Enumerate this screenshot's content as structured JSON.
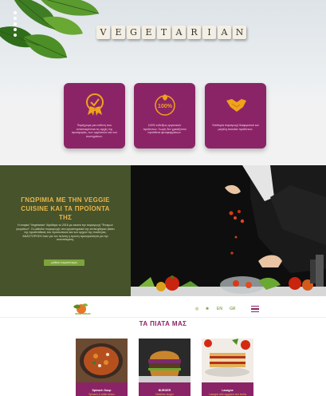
{
  "hero": {
    "tiles": [
      "V",
      "E",
      "G",
      "E",
      "T",
      "A",
      "R",
      "I",
      "A",
      "N"
    ]
  },
  "features": [
    {
      "icon": "award-badge-icon",
      "text": "Παρέχουμε μια ευθύνη που ανταποκρίνεται τις αρχές της προσφοράς, των οργανικών και των συστημάτων."
    },
    {
      "icon": "natural-100-icon",
      "text": "100% ενδείξεις οργανικών προϊόντων. Χωρίς δεν χρειάζονται πρόσθετα φυτοφαρμάκων."
    },
    {
      "icon": "handshake-icon",
      "text": "Επιθυμία παραγωγή διαφορετικό και μεγάλη ποικιλία προϊόντων."
    }
  ],
  "know": {
    "title": "ΓΝΩΡΙΜΙΑ ΜΕ ΤΗΝ VEGGIE CUISINE ΚΑΙ ΤΑ ΠΡΟΪΟΝΤΑ ΤΗΣ",
    "text": "Η εταιρία \"Vegetarian\" ιδρύθηκε το 2016 με σκοπό την παραγωγή \"Έτοιμων γευμάτων\". Οι μέθοδοι παραγωγής στα εργαστηριακά της επιτεύχθηκαν βάσει της προσπάθειας του προσωπικού και των αρχών της ποιότητας. ΑΝΑΣΤΟΡΗΣΗ όταν για τον πελάτη η πρώτη προτεραιότητά για την ανταπόκριση.",
    "button": "μάθετε περισσότερα"
  },
  "nav": {
    "logo_text": "VEGETARIAN",
    "lang_en": "EN",
    "lang_gr": "GR"
  },
  "dishes": {
    "title": "ΤΑ ΠΙΑΤΑ ΜΑΣ",
    "items": [
      {
        "name": "Spinach Soup",
        "sub": "Spinach & white beans"
      },
      {
        "name": "BURGER",
        "sub": "Meatless burger"
      },
      {
        "name": "Lasagne",
        "sub": "Lasagne with eggplant and lentils"
      }
    ]
  },
  "colors": {
    "brand_purple": "#8b2466",
    "olive": "#47532b",
    "accent_gold": "#e9b64a",
    "green": "#7ca43c"
  }
}
